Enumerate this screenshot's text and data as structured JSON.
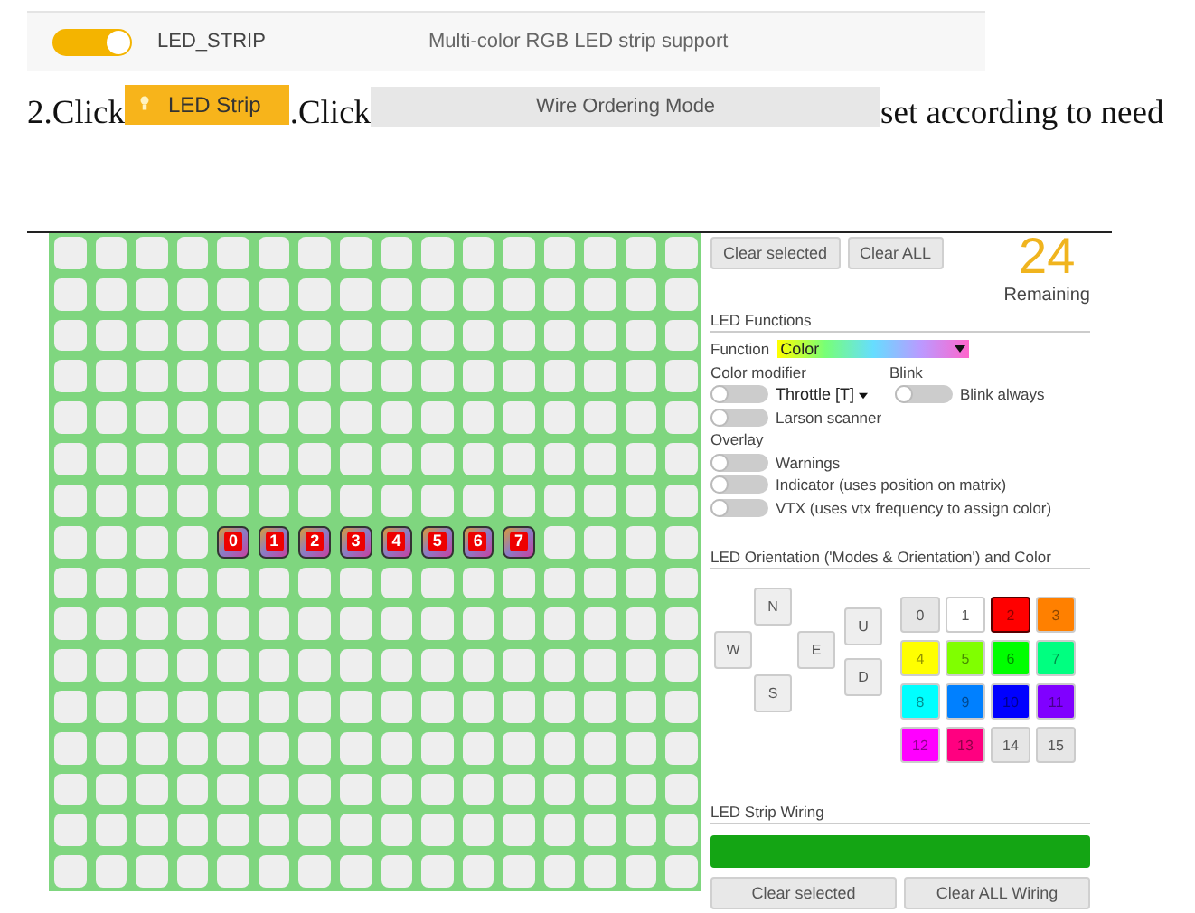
{
  "feature": {
    "enabled": true,
    "name": "LED_STRIP",
    "description": "Multi-color RGB LED strip support"
  },
  "instruction": {
    "lead": "2.Click",
    "tab_button": "LED Strip",
    "middle": ".Click",
    "mode_button": "Wire Ordering Mode",
    "tail": "set according to need"
  },
  "leds": [
    {
      "label": "0"
    },
    {
      "label": "1"
    },
    {
      "label": "2"
    },
    {
      "label": "3"
    },
    {
      "label": "4"
    },
    {
      "label": "5"
    },
    {
      "label": "6"
    },
    {
      "label": "7"
    }
  ],
  "toolbar": {
    "buttons": [
      "Clear selected",
      "Clear ALL"
    ],
    "remaining": "24",
    "remaining_label": "Remaining"
  },
  "functions": {
    "title": "LED Functions",
    "function_label": "Function",
    "function_value": "Color",
    "color_modifier_label": "Color modifier",
    "blink_label": "Blink",
    "modifier_value": "Throttle [T]",
    "modifier_on": false,
    "blink_toggle": {
      "label": "Blink always",
      "on": false
    },
    "larson": {
      "label": "Larson scanner",
      "on": false
    },
    "overlay_label": "Overlay",
    "overlays": [
      {
        "label": "Warnings",
        "on": false
      },
      {
        "label": "Indicator (uses position on matrix)",
        "on": false
      },
      {
        "label": "VTX (uses vtx frequency to assign color)",
        "on": false
      }
    ]
  },
  "orientation": {
    "title": "LED Orientation ('Modes & Orientation') and Color",
    "directions": {
      "n": "N",
      "w": "W",
      "e": "E",
      "s": "S",
      "u": "U",
      "d": "D"
    },
    "colors": [
      {
        "label": "0",
        "color": "#e6e6e6",
        "selected": false
      },
      {
        "label": "1",
        "color": "#ffffff",
        "selected": false
      },
      {
        "label": "2",
        "color": "#ff0000",
        "selected": true
      },
      {
        "label": "3",
        "color": "#ff8000",
        "selected": false
      },
      {
        "label": "4",
        "color": "#ffff00",
        "selected": false
      },
      {
        "label": "5",
        "color": "#80ff00",
        "selected": false
      },
      {
        "label": "6",
        "color": "#00ff00",
        "selected": false
      },
      {
        "label": "7",
        "color": "#00ff80",
        "selected": false
      },
      {
        "label": "8",
        "color": "#00ffff",
        "selected": false
      },
      {
        "label": "9",
        "color": "#0080ff",
        "selected": false
      },
      {
        "label": "10",
        "color": "#0000ff",
        "selected": false
      },
      {
        "label": "11",
        "color": "#8000ff",
        "selected": false
      },
      {
        "label": "12",
        "color": "#ff00ff",
        "selected": false
      },
      {
        "label": "13",
        "color": "#ff0080",
        "selected": false
      },
      {
        "label": "14",
        "color": "#e6e6e6",
        "selected": false
      },
      {
        "label": "15",
        "color": "#e6e6e6",
        "selected": false
      }
    ]
  },
  "wiring": {
    "title": "LED Strip Wiring",
    "buttons": [
      "Clear selected",
      "Clear ALL Wiring"
    ]
  }
}
